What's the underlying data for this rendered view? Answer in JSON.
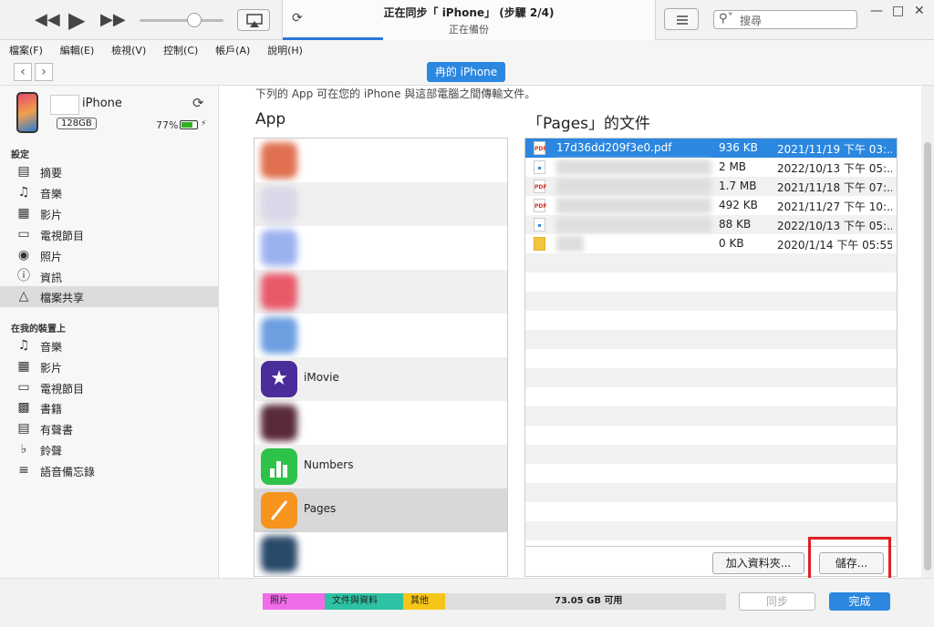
{
  "window": {
    "sync_title": "正在同步「      iPhone」 (步驟 2/4)",
    "sync_subtitle": "正在備份",
    "search_placeholder": "搜尋"
  },
  "menu": [
    "檔案(F)",
    "編輯(E)",
    "檢視(V)",
    "控制(C)",
    "帳戶(A)",
    "說明(H)"
  ],
  "nav": {
    "device_tab": "冉的 iPhone"
  },
  "device": {
    "name": "iPhone",
    "capacity": "128GB",
    "battery": "77%",
    "battery_level": 0.77
  },
  "sidebar": {
    "settings_header": "設定",
    "settings_items": [
      {
        "icon": "summary-icon",
        "label": "摘要"
      },
      {
        "icon": "music-icon",
        "label": "音樂"
      },
      {
        "icon": "movie-icon",
        "label": "影片"
      },
      {
        "icon": "tv-icon",
        "label": "電視節目"
      },
      {
        "icon": "camera-icon",
        "label": "照片"
      },
      {
        "icon": "info-icon",
        "label": "資訊"
      },
      {
        "icon": "app-store-icon",
        "label": "檔案共享"
      }
    ],
    "on_device_header": "在我的裝置上",
    "device_items": [
      {
        "icon": "music-icon",
        "label": "音樂"
      },
      {
        "icon": "movie-icon",
        "label": "影片"
      },
      {
        "icon": "tv-icon",
        "label": "電視節目"
      },
      {
        "icon": "book-icon",
        "label": "書籍"
      },
      {
        "icon": "audiobook-icon",
        "label": "有聲書"
      },
      {
        "icon": "bell-icon",
        "label": "鈴聲"
      },
      {
        "icon": "voice-memo-icon",
        "label": "語音備忘錄"
      }
    ]
  },
  "main": {
    "hint": "下列的 App 可在您的 iPhone 與這部電腦之間傳輸文件。",
    "apps_title": "App",
    "docs_title": "「Pages」的文件",
    "apps": [
      "",
      "",
      "",
      "",
      "",
      "iMovie",
      "",
      "Numbers",
      "Pages",
      ""
    ],
    "documents": [
      {
        "name": "17d36dd209f3e0.pdf",
        "size": "936 KB",
        "date": "2021/11/19 下午 03:..."
      },
      {
        "name": "",
        "size": "2 MB",
        "date": "2022/10/13 下午 05:..."
      },
      {
        "name": "",
        "size": "1.7 MB",
        "date": "2021/11/18 下午 07:..."
      },
      {
        "name": "",
        "size": "492 KB",
        "date": "2021/11/27 下午 10:..."
      },
      {
        "name": "",
        "size": "88 KB",
        "date": "2022/10/13 下午 05:..."
      },
      {
        "name": "",
        "size": "0 KB",
        "date": "2020/1/14 下午 05:55"
      }
    ],
    "add_folder_button": "加入資料夾...",
    "save_button": "儲存..."
  },
  "footer": {
    "segments": [
      {
        "label": "照片",
        "color": "#f06be8"
      },
      {
        "label": "文件與資料",
        "color": "#2ec2a4"
      },
      {
        "label": "其他",
        "color": "#f5c518"
      }
    ],
    "available": "73.05 GB 可用",
    "sync_button": "同步",
    "done_button": "完成"
  }
}
